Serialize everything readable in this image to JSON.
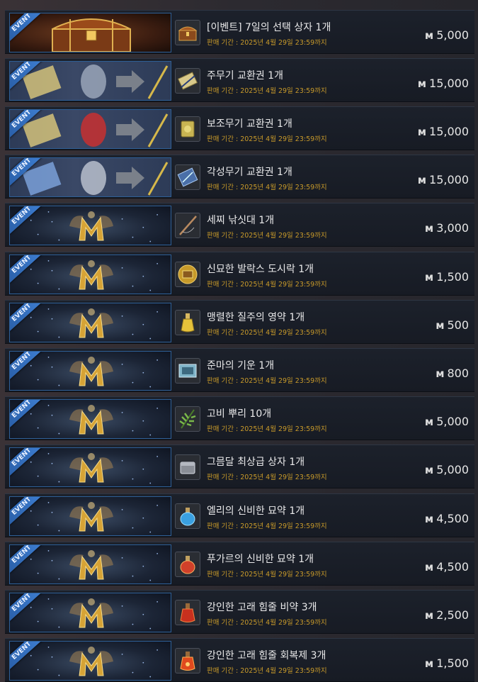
{
  "event_tag": "EVENT",
  "currency_symbol": "ᴍ",
  "colors": {
    "period_text": "#c89a2a",
    "banner_border": "#2e5f96",
    "event_tag": "#3d7dd0"
  },
  "items": [
    {
      "banner": "chest",
      "icon": "treasure-chest-icon",
      "name": "[이벤트] 7일의 선택 상자 1개",
      "period": "판매 기간 : 2025년 4월 29일 23:59까지",
      "price": "5,000"
    },
    {
      "banner": "exchange",
      "icon": "weapon-ticket-icon",
      "name": "주무기 교환권 1개",
      "period": "판매 기간 : 2025년 4월 29일 23:59까지",
      "price": "15,000"
    },
    {
      "banner": "exchange",
      "icon": "sub-weapon-ticket-icon",
      "name": "보조무기 교환권 1개",
      "period": "판매 기간 : 2025년 4월 29일 23:59까지",
      "price": "15,000"
    },
    {
      "banner": "exchange",
      "icon": "awakening-ticket-icon",
      "name": "각성무기 교환권 1개",
      "period": "판매 기간 : 2025년 4월 29일 23:59까지",
      "price": "15,000"
    },
    {
      "banner": "emblem",
      "icon": "fishing-rod-icon",
      "name": "세찌 낚싯대 1개",
      "period": "판매 기간 : 2025년 4월 29일 23:59까지",
      "price": "3,000"
    },
    {
      "banner": "emblem",
      "icon": "lunchbox-icon",
      "name": "신묘한 발락스 도시락 1개",
      "period": "판매 기간 : 2025년 4월 29일 23:59까지",
      "price": "1,500"
    },
    {
      "banner": "emblem",
      "icon": "potion-flask-icon",
      "name": "맹렬한 질주의 영약 1개",
      "period": "판매 기간 : 2025년 4월 29일 23:59까지",
      "price": "500"
    },
    {
      "banner": "emblem",
      "icon": "scroll-icon",
      "name": "준마의 기운 1개",
      "period": "판매 기간 : 2025년 4월 29일 23:59까지",
      "price": "800"
    },
    {
      "banner": "emblem",
      "icon": "fern-root-icon",
      "name": "고비 뿌리 10개",
      "period": "판매 기간 : 2025년 4월 29일 23:59까지",
      "price": "5,000"
    },
    {
      "banner": "emblem",
      "icon": "silver-box-icon",
      "name": "그믐달 최상급 상자 1개",
      "period": "판매 기간 : 2025년 4월 29일 23:59까지",
      "price": "5,000"
    },
    {
      "banner": "emblem",
      "icon": "blue-elixir-icon",
      "name": "엘리의 신비한 묘약 1개",
      "period": "판매 기간 : 2025년 4월 29일 23:59까지",
      "price": "4,500"
    },
    {
      "banner": "emblem",
      "icon": "red-elixir-icon",
      "name": "푸가르의 신비한 묘약 1개",
      "period": "판매 기간 : 2025년 4월 29일 23:59까지",
      "price": "4,500"
    },
    {
      "banner": "emblem",
      "icon": "red-potion-icon",
      "name": "강인한 고래 힘줄 비약 3개",
      "period": "판매 기간 : 2025년 4월 29일 23:59까지",
      "price": "2,500"
    },
    {
      "banner": "emblem",
      "icon": "red-restorative-icon",
      "name": "강인한 고래 힘줄 회복제 3개",
      "period": "판매 기간 : 2025년 4월 29일 23:59까지",
      "price": "1,500"
    }
  ]
}
